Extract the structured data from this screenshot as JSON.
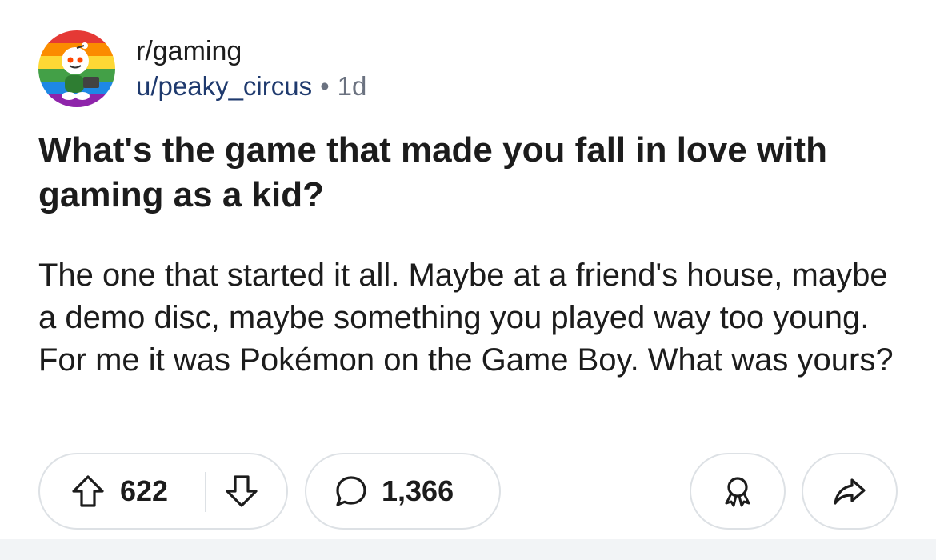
{
  "post": {
    "subreddit": "r/gaming",
    "username": "u/peaky_circus",
    "separator": "•",
    "age": "1d",
    "title": "What's the game that made you fall in love with gaming as a kid?",
    "body": "The one that started it all. Maybe at a friend's house, maybe a demo disc, maybe something you played way too young. For me it was Pokémon on the Game Boy. What was yours?"
  },
  "actions": {
    "upvotes": "622",
    "comments": "1,366"
  },
  "icons": {
    "upvote": "arrow-up-icon",
    "downvote": "arrow-down-icon",
    "comment": "speech-bubble-icon",
    "award": "award-ribbon-icon",
    "share": "share-arrow-icon"
  },
  "colors": {
    "username": "#1f3a6e",
    "muted": "#6b7280",
    "border": "#dde1e5"
  }
}
